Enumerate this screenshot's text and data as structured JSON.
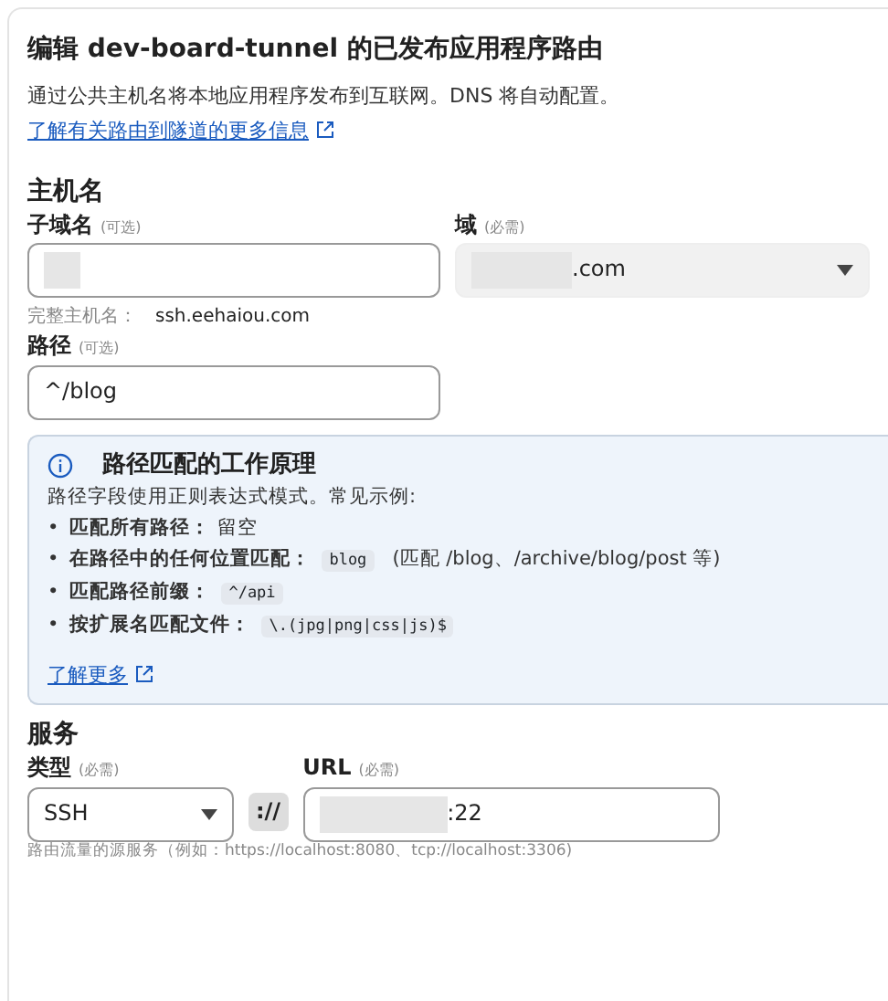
{
  "title_prefix": "编辑 ",
  "title_name": "dev-board-tunnel",
  "title_suffix": " 的已发布应用程序路由",
  "description": "通过公共主机名将本地应用程序发布到互联网。DNS 将自动配置。",
  "learn_link": "了解有关路由到隧道的更多信息",
  "hostname": {
    "heading": "主机名",
    "subdomain": {
      "label": "子域名",
      "hint": "(可选)",
      "redacted": true
    },
    "domain": {
      "label": "域",
      "hint": "(必需)",
      "value": ".com",
      "redacted": true
    },
    "full_label": "完整主机名：",
    "full_value": "ssh.eehaiou.com",
    "path": {
      "label": "路径",
      "hint": "(可选)",
      "value": "^/blog"
    }
  },
  "info": {
    "title": "路径匹配的工作原理",
    "intro": "路径字段使用正则表达式模式。常见示例:",
    "items": [
      {
        "marker": "•",
        "label": "匹配所有路径：",
        "text": "留空"
      },
      {
        "marker": "•",
        "label": "在路径中的任何位置匹配：",
        "code": "blog",
        "text": "(匹配 /blog、/archive/blog/post 等)"
      },
      {
        "marker": "•",
        "label": "匹配路径前缀：",
        "code": "^/api"
      },
      {
        "marker": "•",
        "label": "按扩展名匹配文件：",
        "code": "\\.(jpg|png|css|js)$"
      }
    ],
    "link": "了解更多"
  },
  "service": {
    "heading": "服务",
    "type": {
      "label": "类型",
      "hint": "(必需)",
      "value": "SSH"
    },
    "separator": "://",
    "url": {
      "label": "URL",
      "hint": "(必需)",
      "value": ":22",
      "redacted": true
    },
    "help": "路由流量的源服务（例如：https://localhost:8080、tcp://localhost:3306)"
  }
}
